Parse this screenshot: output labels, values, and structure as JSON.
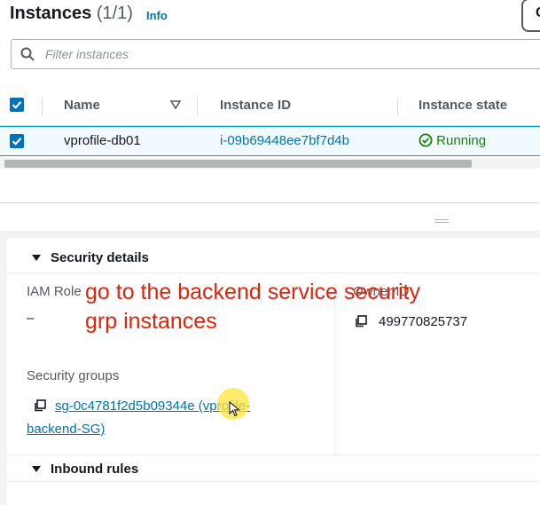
{
  "header": {
    "title": "Instances",
    "count": "(1/1)",
    "info_link": "Info",
    "right_button_label": "C"
  },
  "search": {
    "placeholder": "Filter instances"
  },
  "table": {
    "columns": [
      "Name",
      "Instance ID",
      "Instance state"
    ],
    "header_checkbox_checked": true,
    "rows": [
      {
        "selected": true,
        "name": "vprofile-db01",
        "instance_id": "i-09b69448ee7bf7d4b",
        "state": "Running"
      }
    ]
  },
  "details": {
    "section_title": "Security details",
    "iam_role_label": "IAM Role",
    "iam_role_value": "–",
    "owner_label": "Owner ID",
    "owner_value": "499770825737",
    "security_groups_label": "Security groups",
    "security_group_link_line1": "sg-0c4781f2d5b09344e (vprofile-",
    "security_group_link_line2": "backend-SG)",
    "inbound_rules_title": "Inbound rules"
  },
  "annotation": {
    "line1": "go to the backend service security",
    "line2": "grp instances"
  },
  "colors": {
    "accent": "#0073bb",
    "running": "#1d8102",
    "annotation": "#e0240b",
    "selected_row_bg": "#f1faff"
  },
  "icons": {
    "search": "search-icon",
    "sort": "sort-down-icon",
    "status": "check-circle-icon",
    "copy": "copy-icon",
    "caret": "caret-down-icon"
  }
}
